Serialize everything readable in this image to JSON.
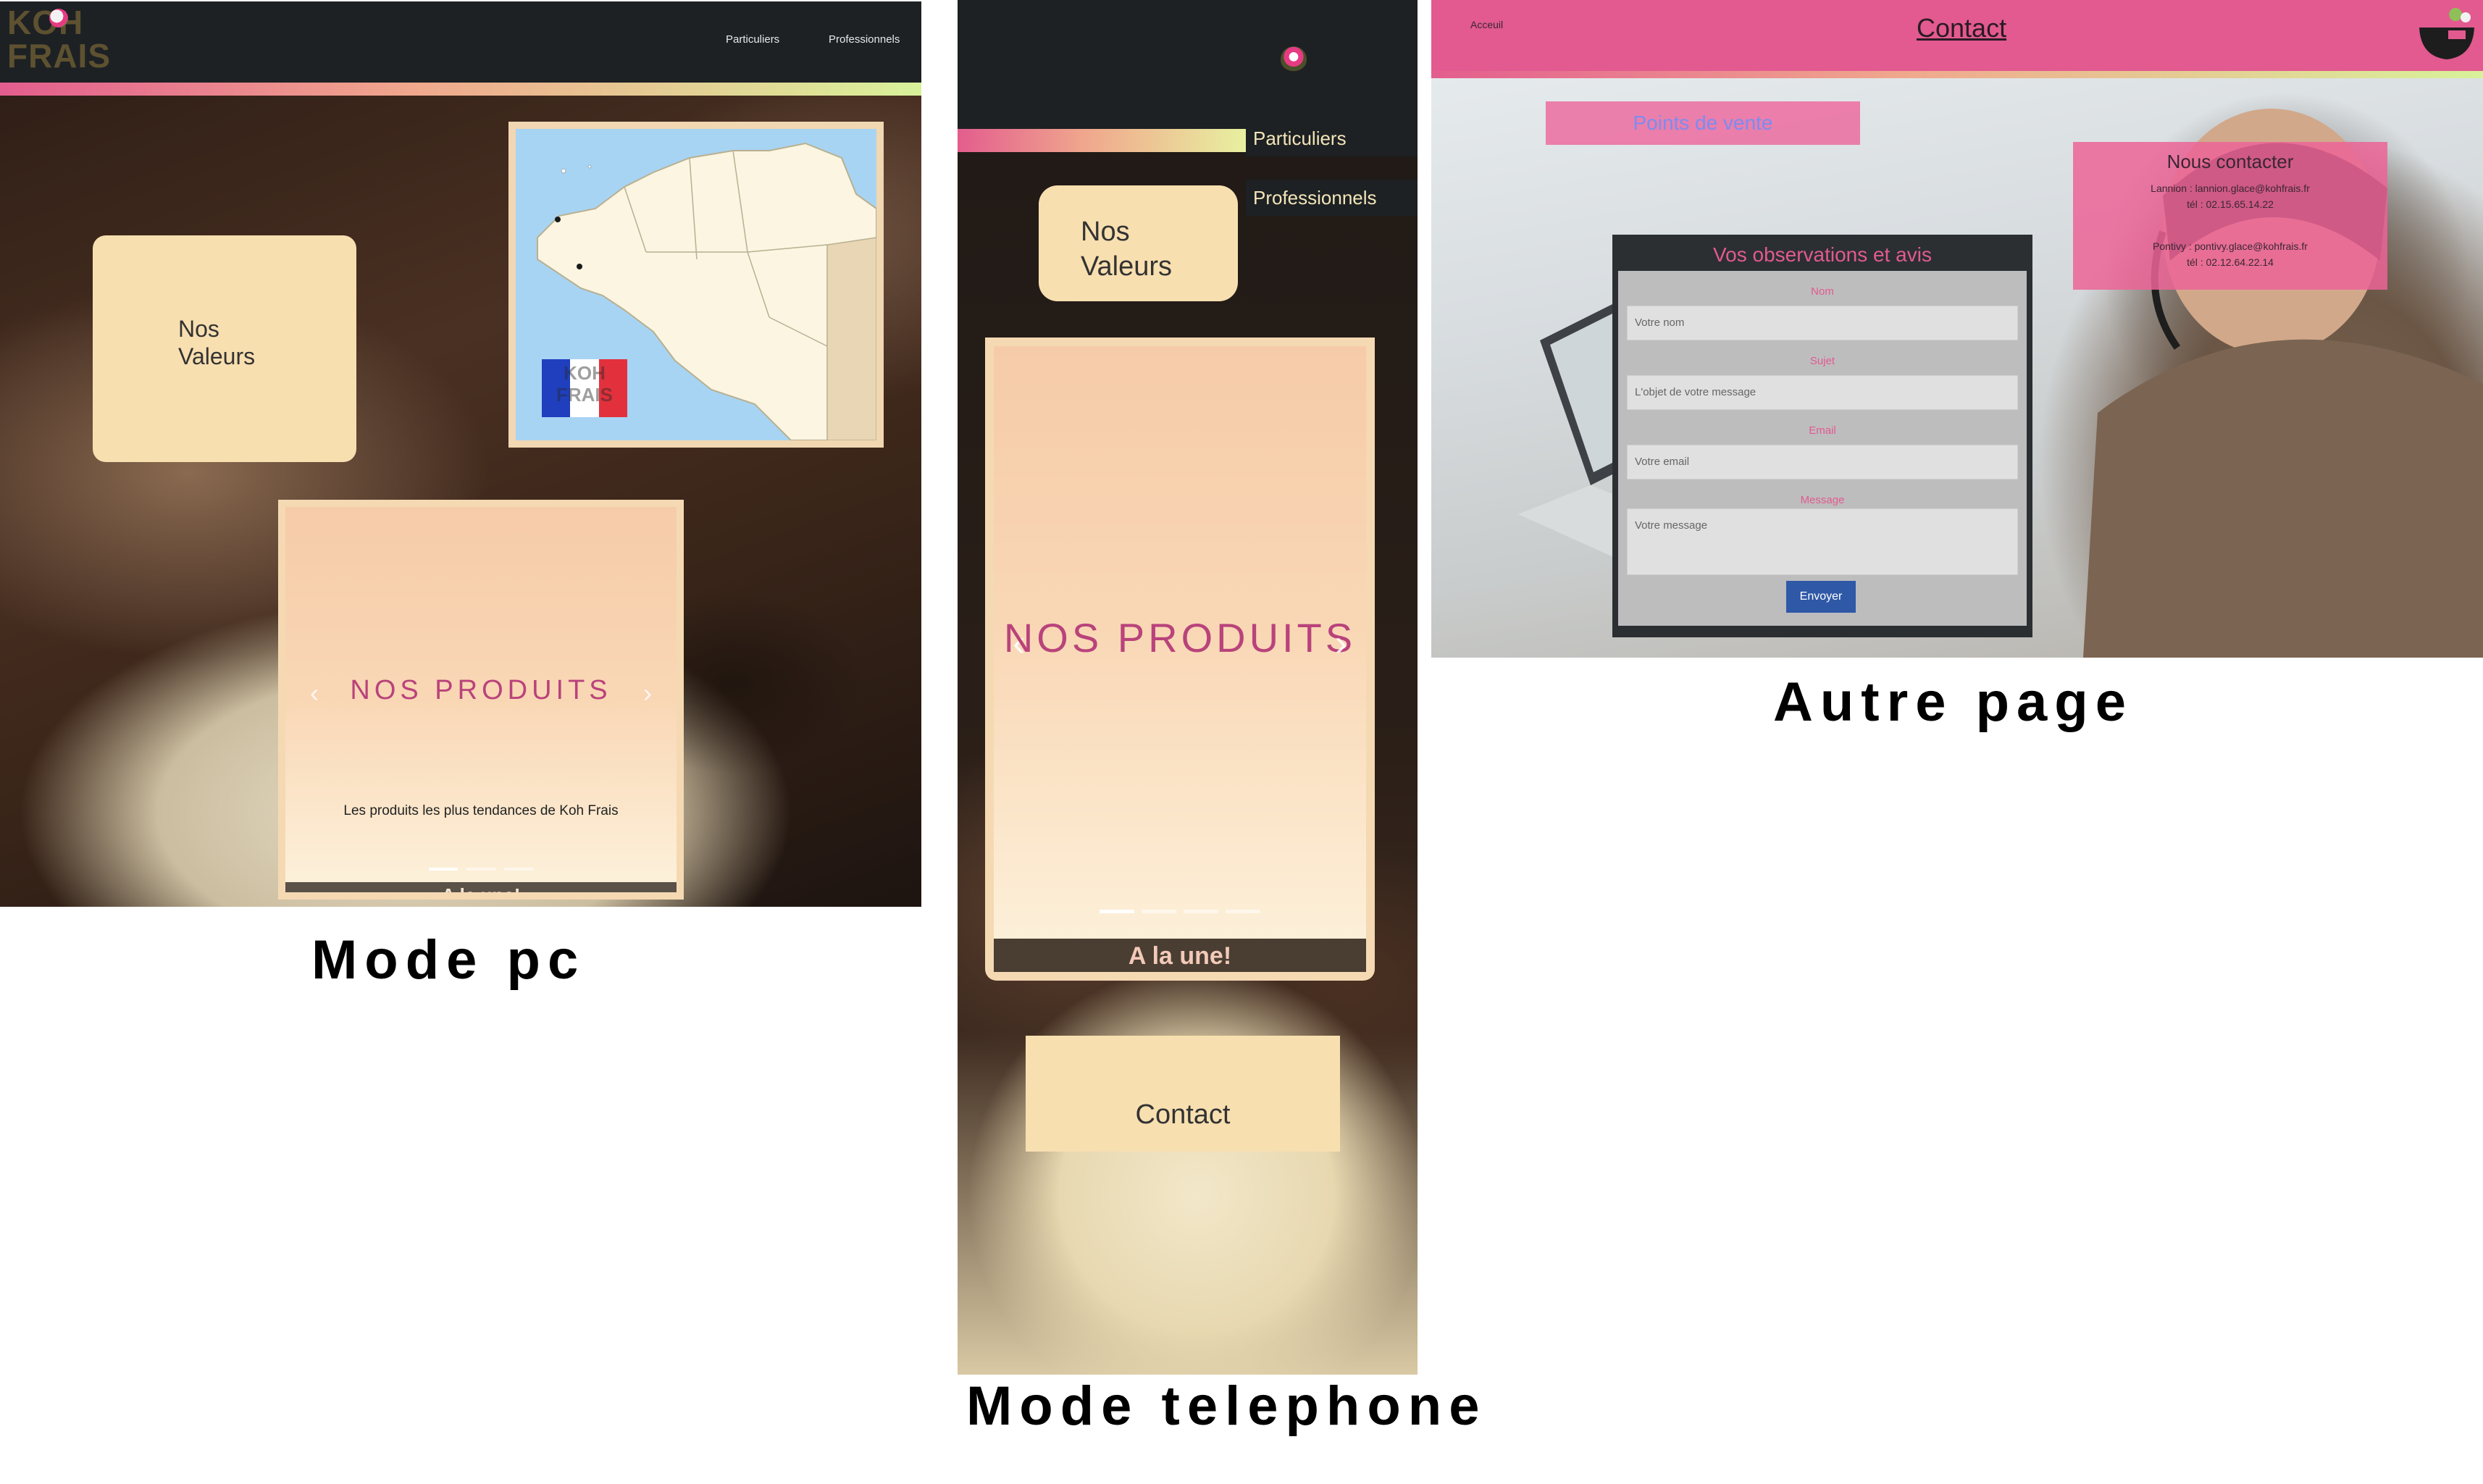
{
  "pc": {
    "logo_text": [
      "KOH",
      "FRAIS"
    ],
    "nav": [
      "Particuliers",
      "Professionnels"
    ],
    "valeurs": [
      "Nos",
      "Valeurs"
    ],
    "map_badge": [
      "KOH",
      "FRAIS"
    ],
    "product_title": "NOS PRODUITS",
    "product_caption": "Les produits les plus tendances de Koh Frais",
    "headline": "A la une!",
    "caption": "Mode pc"
  },
  "phone": {
    "menu": [
      "Particuliers",
      "Professionnels"
    ],
    "valeurs": [
      "Nos",
      "Valeurs"
    ],
    "product_title": "NOS PRODUITS",
    "headline": "A la une!",
    "contact": "Contact",
    "caption": "Mode telephone"
  },
  "other": {
    "home_link": "Acceuil",
    "title": "Contact",
    "points_de_vente": "Points de vente",
    "contact_box": {
      "heading": "Nous contacter",
      "lines": [
        "Lannion : lannion.glace@kohfrais.fr",
        "tél : 02.15.65.14.22",
        "Pontivy : pontivy.glace@kohfrais.fr",
        "tél : 02.12.64.22.14"
      ]
    },
    "form": {
      "title": "Vos observations et avis",
      "fields": [
        {
          "label": "Nom",
          "placeholder": "Votre nom"
        },
        {
          "label": "Sujet",
          "placeholder": "L'objet de votre message"
        },
        {
          "label": "Email",
          "placeholder": "Votre email"
        },
        {
          "label": "Message",
          "placeholder": "Votre message"
        }
      ],
      "submit": "Envoyer"
    },
    "caption": "Autre page"
  },
  "colors": {
    "dark_nav": "#1d2124",
    "card_cream": "#f8dfb0",
    "brand_pink": "#e25a8f",
    "product_title": "#b9437b",
    "submit_blue": "#2f59a6"
  }
}
